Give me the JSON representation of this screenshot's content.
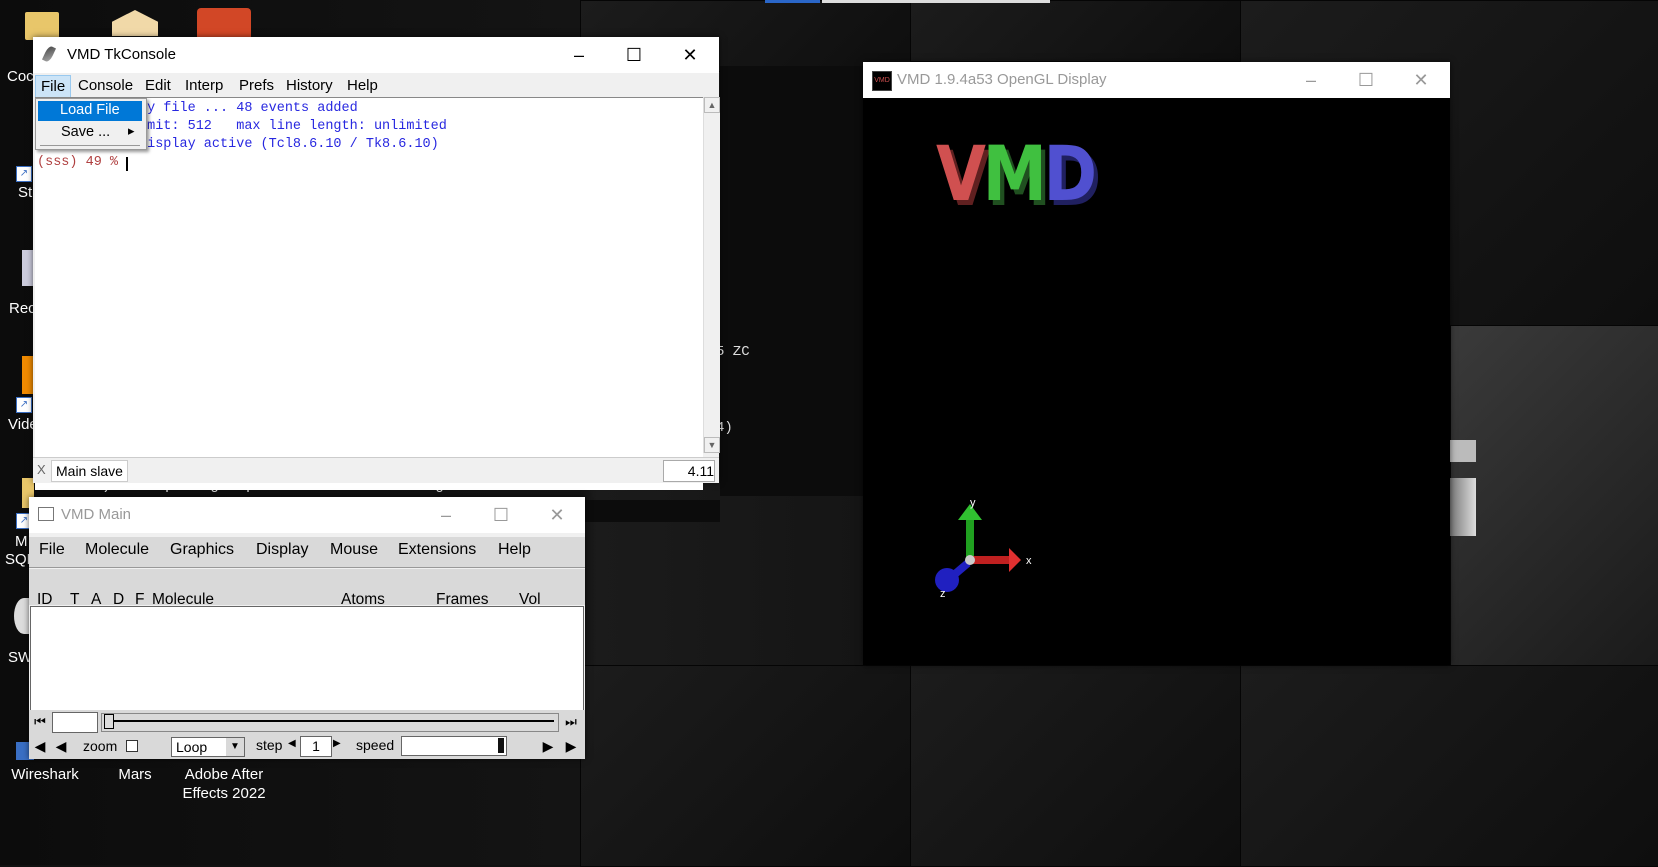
{
  "desktop": {
    "icons": [
      {
        "label": "Wireshark",
        "icon": "wireshark-icon"
      },
      {
        "label": "Mars",
        "icon": "mars-icon"
      },
      {
        "label": "Adobe After Effects 2022",
        "label_line1": "Adobe After",
        "label_line2": "Effects 2022",
        "icon": "after-effects-icon"
      }
    ],
    "edge_labels": [
      "Coc",
      "St",
      "Rec",
      "Vide",
      "M",
      "SQL",
      "SW"
    ]
  },
  "background_text": {
    "line1": "5 ZC",
    "line2": "4)",
    "line3": "Info)   Compiling  OptiX shaders on 1 target GPU..."
  },
  "tkconsole": {
    "title": "VMD TkConsole",
    "menu": [
      "File",
      "Console",
      "Edit",
      "Interp",
      "Prefs",
      "History",
      "Help"
    ],
    "file_menu": {
      "load": "Load File",
      "save": "Save ...",
      "save_arrow": "▸"
    },
    "lines": [
      "ry file ... 48 events added",
      "imit: 512   max line length: unlimited",
      "display active (Tcl8.6.10 / Tk8.6.10)"
    ],
    "prompt": "(sss) 49 %",
    "status_left": "X",
    "status_label": "Main slave",
    "status_right": "4.11"
  },
  "vmd_main": {
    "title": "VMD Main",
    "menu": [
      "File",
      "Molecule",
      "Graphics",
      "Display",
      "Mouse",
      "Extensions",
      "Help"
    ],
    "columns": {
      "id": "ID",
      "t": "T",
      "a": "A",
      "d": "D",
      "f": "F",
      "molecule": "Molecule",
      "atoms": "Atoms",
      "frames": "Frames",
      "vol": "Vol"
    },
    "controls": {
      "zoom_label": "zoom",
      "loop_value": "Loop",
      "step_label": "step",
      "step_value": "1",
      "speed_label": "speed"
    }
  },
  "opengl": {
    "title": "VMD 1.9.4a53 OpenGL Display",
    "logo": {
      "v": "V",
      "m": "M",
      "d": "D"
    },
    "axes": {
      "x": "x",
      "y": "y",
      "z": "z"
    }
  },
  "colors": {
    "console_text": "#2828e0",
    "prompt": "#b04040",
    "menu_highlight": "#0078d7",
    "logo_v": "#d05050",
    "logo_m": "#40c040",
    "logo_d": "#5050d0"
  }
}
